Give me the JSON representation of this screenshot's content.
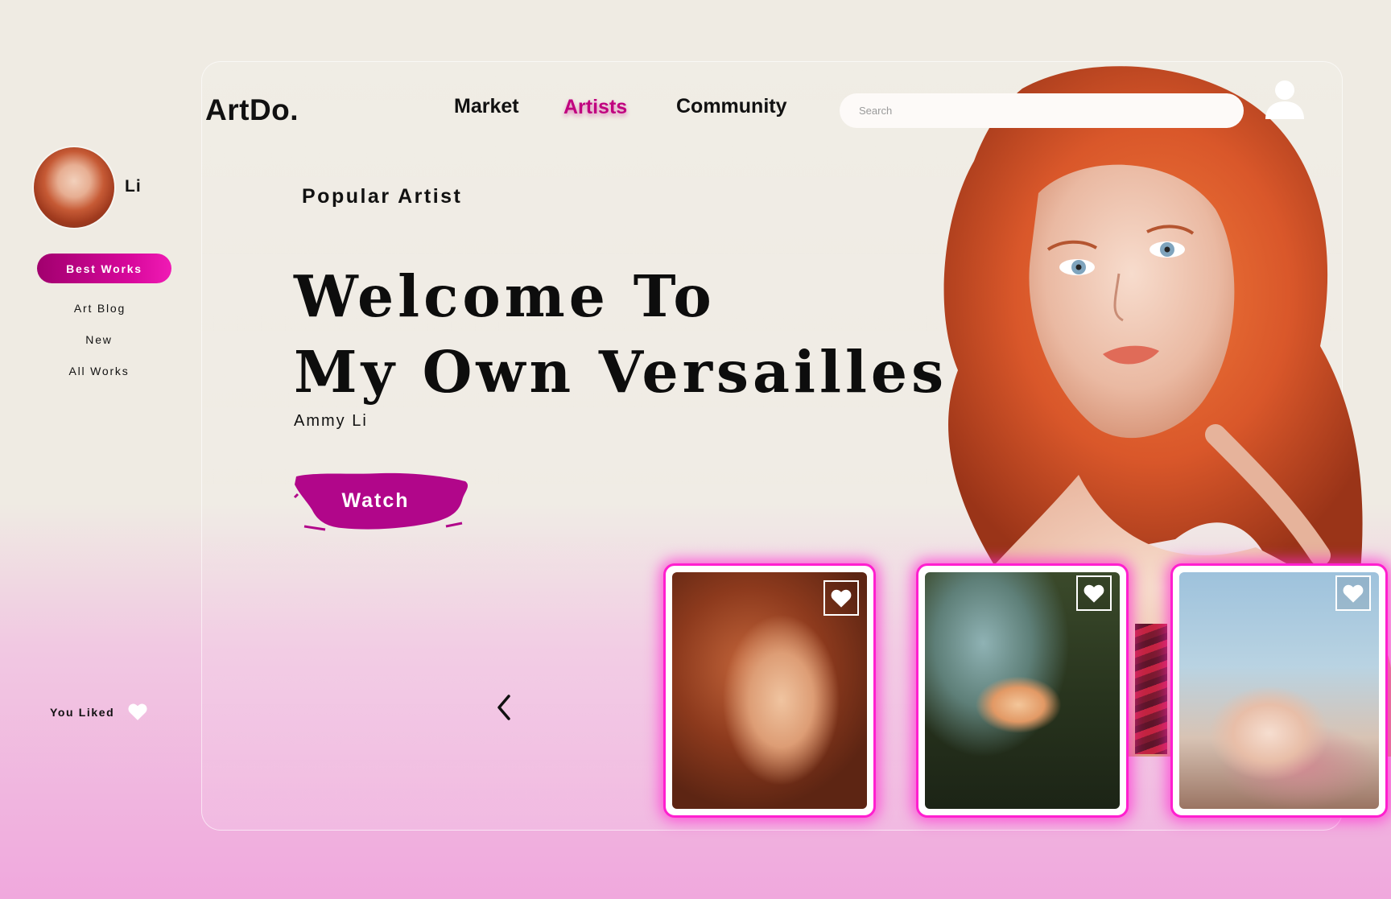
{
  "sidebar": {
    "user_name": "Li",
    "items": [
      {
        "label": "Best Works",
        "active": true
      },
      {
        "label": "Art Blog"
      },
      {
        "label": "New"
      },
      {
        "label": "All Works"
      }
    ],
    "you_liked_label": "You Liked"
  },
  "header": {
    "logo": "ArtDo.",
    "nav": [
      {
        "label": "Market"
      },
      {
        "label": "Artists",
        "active": true
      },
      {
        "label": "Community"
      }
    ],
    "search": {
      "placeholder": "Search",
      "value": ""
    }
  },
  "hero": {
    "kicker": "Popular Artist",
    "title_line1": "Welcome To",
    "title_line2": "My Own Versailles",
    "artist": "Ammy Li",
    "watch_label": "Watch"
  },
  "icons": {
    "user": "user-icon",
    "heart": "heart-icon",
    "prev": "chevron-left-icon"
  },
  "colors": {
    "accent": "#d8089c",
    "glow": "#ff1fcf",
    "background_top": "#efebe3",
    "background_bottom": "#f0a8dd"
  }
}
